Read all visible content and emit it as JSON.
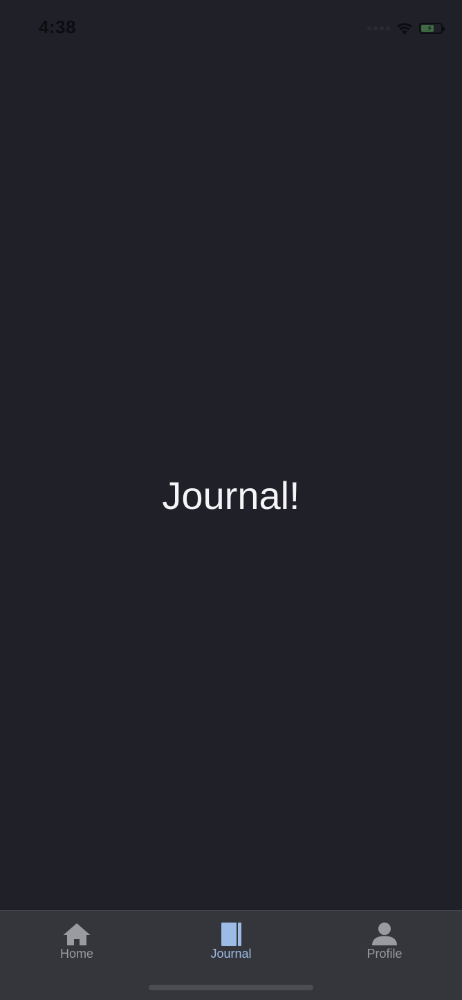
{
  "status_bar": {
    "time": "4:38",
    "icons": [
      "signal-icon",
      "wifi-icon",
      "battery-icon"
    ]
  },
  "main": {
    "title": "Journal!"
  },
  "tab_bar": {
    "tabs": [
      {
        "label": "Home",
        "icon": "home-icon",
        "active": false
      },
      {
        "label": "Journal",
        "icon": "journal-icon",
        "active": true
      },
      {
        "label": "Profile",
        "icon": "profile-icon",
        "active": false
      }
    ]
  },
  "colors": {
    "background": "#1f2028",
    "tab_bar": "#35363b",
    "active_tab": "#9cbbe6",
    "inactive_tab": "#9a9ba0",
    "title_text": "#f5f5f7"
  }
}
